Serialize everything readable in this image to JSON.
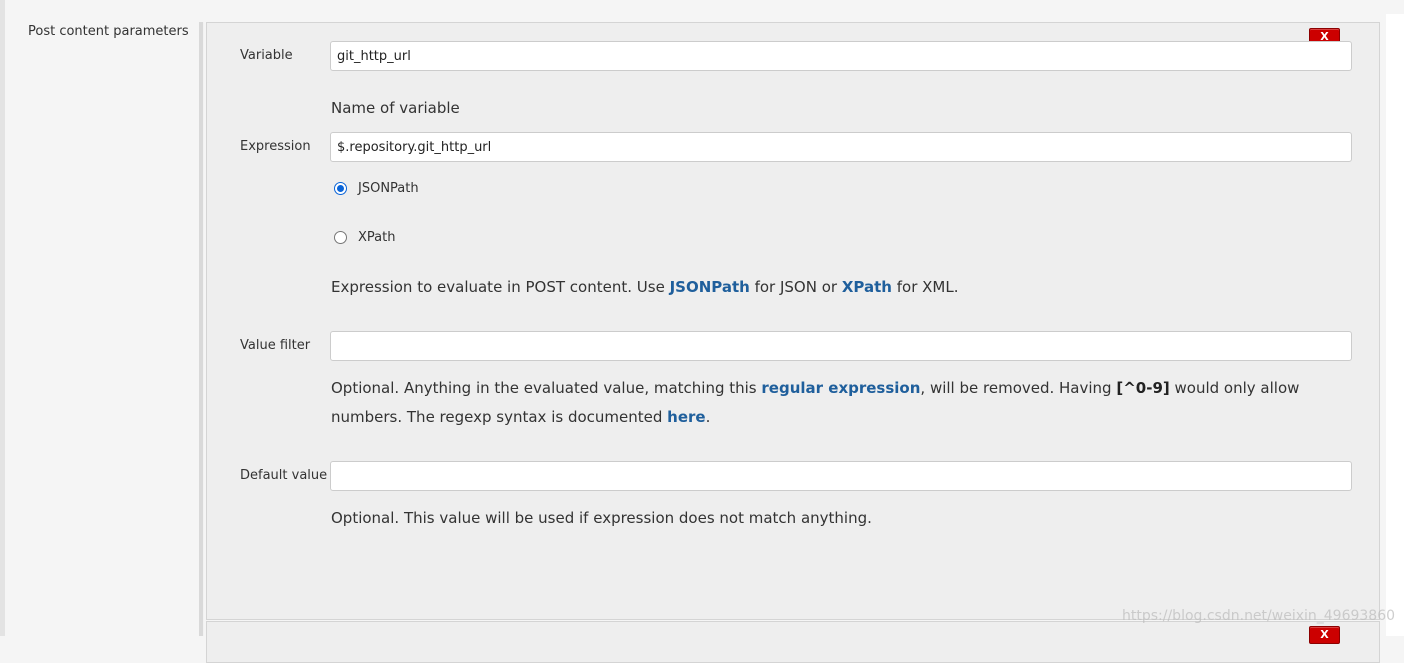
{
  "section": {
    "label": "Post content parameters"
  },
  "delete_button": {
    "label": "X"
  },
  "fields": {
    "variable": {
      "label": "Variable",
      "value": "git_http_url",
      "help": "Name of variable"
    },
    "expression": {
      "label": "Expression",
      "value": "$.repository.git_http_url",
      "options": [
        {
          "label": "JSONPath",
          "selected": true
        },
        {
          "label": "XPath",
          "selected": false
        }
      ],
      "help": {
        "prefix": "Expression to evaluate in POST content. Use ",
        "link1": "JSONPath",
        "middle": " for JSON or ",
        "link2": "XPath",
        "suffix": " for XML."
      }
    },
    "value_filter": {
      "label": "Value filter",
      "value": "",
      "help": {
        "prefix": "Optional. Anything in the evaluated value, matching this ",
        "link1": "regular expression",
        "middle": ", will be removed. Having ",
        "code": "[^0-9]",
        "middle2": " would only allow numbers. The regexp syntax is documented ",
        "link2": "here",
        "suffix": "."
      }
    },
    "default_value": {
      "label": "Default value",
      "value": "",
      "help": "Optional. This value will be used if expression does not match anything."
    }
  },
  "watermark": "https://blog.csdn.net/weixin_49693860",
  "colors": {
    "accent_link": "#1f5f9c",
    "delete_red": "#cc0000",
    "radio_blue": "#0a64d8"
  }
}
